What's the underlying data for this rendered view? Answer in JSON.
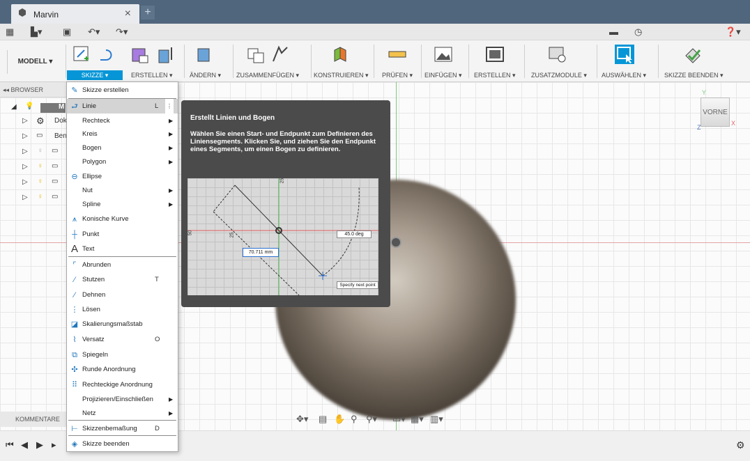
{
  "window": {
    "tab_title": "Marvin",
    "new_tab": "+",
    "close": "×"
  },
  "ribbon": {
    "workspace": "MODELL ▾",
    "groups": [
      {
        "label": "SKIZZE ▾",
        "active": true
      },
      {
        "label": "ERSTELLEN ▾"
      },
      {
        "label": "ÄNDERN ▾"
      },
      {
        "label": "ZUSAMMENFÜGEN ▾"
      },
      {
        "label": "KONSTRUIEREN ▾"
      },
      {
        "label": "PRÜFEN ▾"
      },
      {
        "label": "EINFÜGEN ▾"
      },
      {
        "label": "ERSTELLEN ▾"
      },
      {
        "label": "ZUSATZMODULE ▾"
      },
      {
        "label": "AUSWÄHLEN ▾"
      },
      {
        "label": "SKIZZE BEENDEN ▾"
      }
    ]
  },
  "browser": {
    "header": "BROWSER",
    "rows": [
      {
        "label": "M"
      },
      {
        "label": "Dok"
      },
      {
        "label": "Ben"
      },
      {
        "label": ""
      },
      {
        "label": ""
      },
      {
        "label": ""
      },
      {
        "label": ""
      }
    ]
  },
  "comments_header": "KOMMENTARE",
  "viewcube": {
    "label": "VORNE",
    "axis_x": "X",
    "axis_y": "Y",
    "axis_z": "Z"
  },
  "menu": {
    "items": [
      {
        "label": "Skizze erstellen",
        "icon": "sketch-create-icon"
      },
      {
        "label": "Linie",
        "shortcut": "L",
        "icon": "line-icon",
        "highlight": true
      },
      {
        "label": "Rechteck",
        "submenu": true
      },
      {
        "label": "Kreis",
        "submenu": true
      },
      {
        "label": "Bogen",
        "submenu": true
      },
      {
        "label": "Polygon",
        "submenu": true
      },
      {
        "label": "Ellipse",
        "icon": "ellipse-icon"
      },
      {
        "label": "Nut",
        "submenu": true
      },
      {
        "label": "Spline",
        "submenu": true
      },
      {
        "label": "Konische Kurve",
        "icon": "conic-curve-icon"
      },
      {
        "label": "Punkt",
        "icon": "point-icon"
      },
      {
        "label": "Text",
        "icon": "text-icon"
      },
      {
        "label": "Abrunden",
        "icon": "fillet-icon"
      },
      {
        "label": "Stutzen",
        "shortcut": "T",
        "icon": "trim-icon"
      },
      {
        "label": "Dehnen",
        "icon": "extend-icon"
      },
      {
        "label": "Lösen",
        "icon": "break-icon"
      },
      {
        "label": "Skalierungsmaßstab",
        "icon": "scale-icon"
      },
      {
        "label": "Versatz",
        "shortcut": "O",
        "icon": "offset-icon"
      },
      {
        "label": "Spiegeln",
        "icon": "mirror-icon"
      },
      {
        "label": "Runde Anordnung",
        "icon": "circular-pattern-icon"
      },
      {
        "label": "Rechteckige Anordnung",
        "icon": "rectangular-pattern-icon"
      },
      {
        "label": "Projizieren/Einschließen",
        "submenu": true
      },
      {
        "label": "Netz",
        "submenu": true
      },
      {
        "label": "Skizzenbemaßung",
        "shortcut": "D",
        "icon": "dimension-icon"
      },
      {
        "label": "Skizze beenden",
        "icon": "finish-sketch-icon"
      }
    ]
  },
  "tooltip": {
    "title": "Erstellt Linien und Bogen",
    "description": "Wählen Sie einen Start- und Endpunkt zum Definieren des Liniensegments. Klicken Sie, und ziehen Sie den Endpunkt eines Segments, um einen Bogen zu definieren.",
    "image": {
      "length_label": "70.711 mm",
      "angle_label": "45.0 deg",
      "prompt": "Specify next point",
      "dim_25_a": "25",
      "dim_25_b": "25",
      "dim_50": "50"
    }
  },
  "colors": {
    "accent": "#0696d7",
    "tab_bar": "#50667d",
    "tooltip": "#4b4b4b"
  }
}
